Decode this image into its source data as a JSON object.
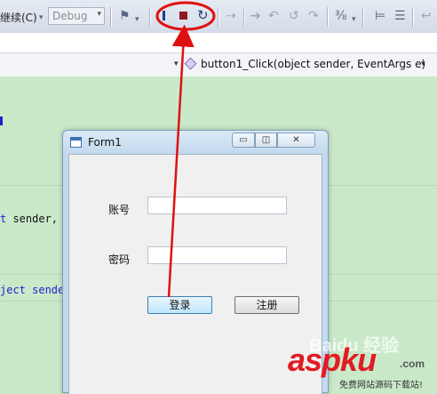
{
  "toolbar": {
    "continue_label": "继续(C)",
    "config_value": "Debug",
    "icons": [
      "attach-process-icon",
      "break-all-icon",
      "stop-debugging-icon",
      "restart-icon",
      "show-next-statement-icon",
      "step-into-icon",
      "step-over-icon",
      "step-out-icon",
      "hex-display-icon",
      "breakpoints-icon",
      "more-icon"
    ]
  },
  "navbar": {
    "member_label": "button1_Click(object sender, EventArgs e)"
  },
  "code": {
    "line1_kw": "t",
    "line1_rest": " sender,",
    "line2_text": "ject sende"
  },
  "form": {
    "title": "Form1",
    "account_label": "账号",
    "password_label": "密码",
    "login_button": "登录",
    "register_button": "注册",
    "account_value": "",
    "password_value": ""
  },
  "colors": {
    "annotation": "#e01010",
    "editor_bg": "#c9e9c9"
  },
  "watermark": {
    "baidu": "Baidu 经验",
    "brand_asp": "asp",
    "brand_ku": "ku",
    "brand_tld": ".com",
    "tagline": "免费网站源码下载站!"
  }
}
